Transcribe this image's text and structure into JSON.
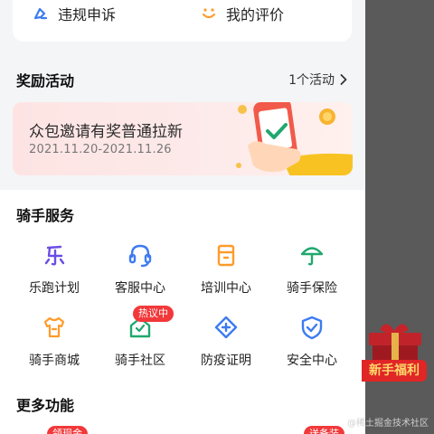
{
  "top": {
    "left_label": "违规申诉",
    "right_label": "我的评价"
  },
  "rewards": {
    "title": "奖励活动",
    "more": "1个活动",
    "banner_title": "众包邀请有奖普通拉新",
    "banner_date": "2021.11.20-2021.11.26"
  },
  "services": {
    "title": "骑手服务",
    "items": [
      {
        "label": "乐跑计划",
        "icon": "le-icon"
      },
      {
        "label": "客服中心",
        "icon": "headset-icon"
      },
      {
        "label": "培训中心",
        "icon": "clipboard-icon"
      },
      {
        "label": "骑手保险",
        "icon": "umbrella-icon"
      },
      {
        "label": "骑手商城",
        "icon": "tshirt-icon"
      },
      {
        "label": "骑手社区",
        "icon": "house-icon",
        "badge": "热议中"
      },
      {
        "label": "防疫证明",
        "icon": "plus-diamond-icon"
      },
      {
        "label": "安全中心",
        "icon": "shield-check-icon"
      }
    ]
  },
  "more": {
    "title": "更多功能",
    "badge_left": "领现金",
    "badge_right": "送备装"
  },
  "promo": {
    "text": "新手福利"
  },
  "watermark": "@稀土掘金技术社区",
  "colors": {
    "accent_blue": "#3d7bf2",
    "accent_orange": "#ff9b2b",
    "accent_purple": "#6b4de6",
    "accent_green": "#1fa86d",
    "badge_red": "#f2383a"
  }
}
